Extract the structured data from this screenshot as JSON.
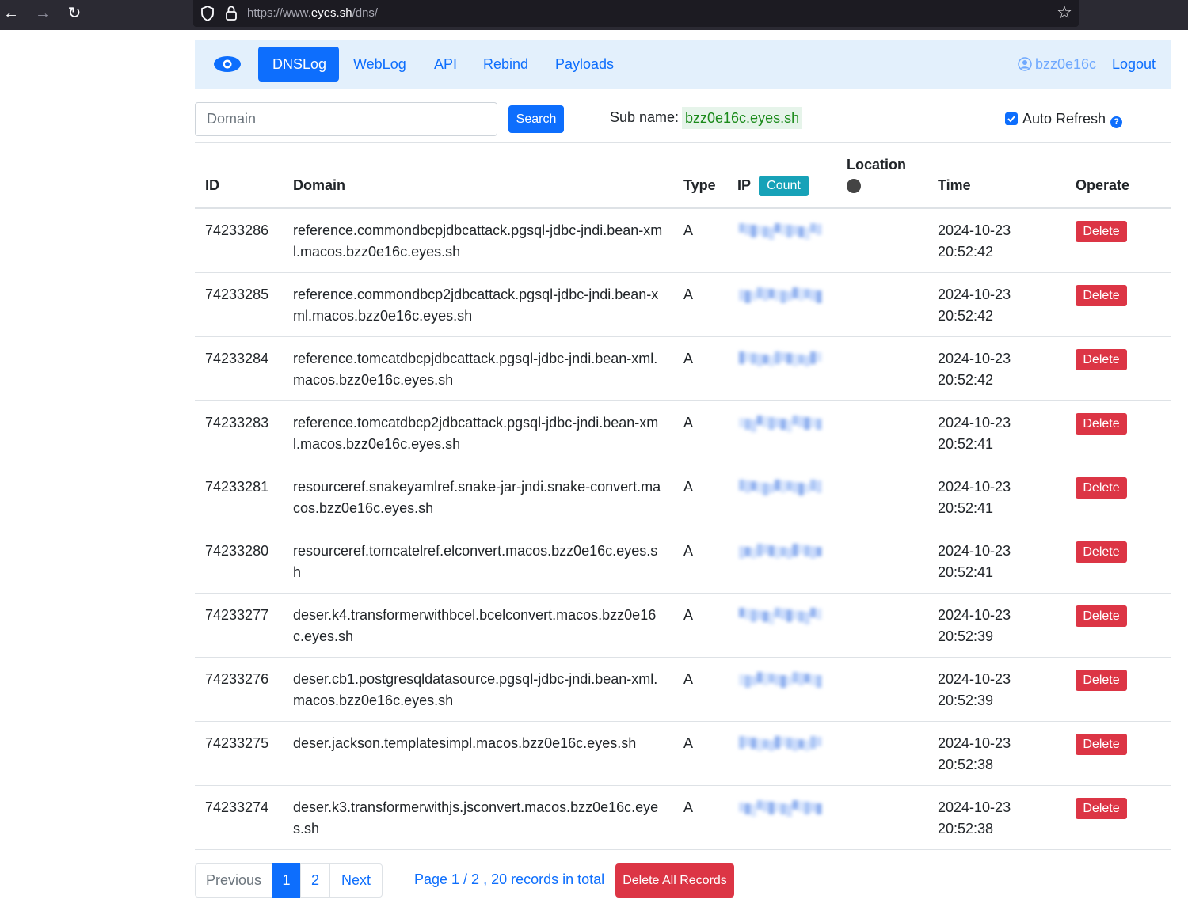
{
  "browser": {
    "url_prefix": "https://www.",
    "url_host": "eyes.sh",
    "url_path": "/dns/"
  },
  "navbar": {
    "items": [
      "DNSLog",
      "WebLog",
      "API",
      "Rebind",
      "Payloads"
    ],
    "active": "DNSLog",
    "username": "bzz0e16c",
    "logout_label": "Logout"
  },
  "search": {
    "placeholder": "Domain",
    "button_label": "Search",
    "subname_label": "Sub name:",
    "subname_value": "bzz0e16c.eyes.sh",
    "auto_refresh_label": "Auto Refresh",
    "auto_refresh_checked": true
  },
  "table": {
    "headers": {
      "id": "ID",
      "domain": "Domain",
      "type": "Type",
      "ip": "IP",
      "count": "Count",
      "location": "Location",
      "time": "Time",
      "operate": "Operate"
    },
    "delete_label": "Delete",
    "rows": [
      {
        "id": "74233286",
        "domain": "reference.commondbcpjdbcattack.pgsql-jdbc-jndi.bean-xml.macos.bzz0e16c.eyes.sh",
        "type": "A",
        "time": "2024-10-23 20:52:42"
      },
      {
        "id": "74233285",
        "domain": "reference.commondbcp2jdbcattack.pgsql-jdbc-jndi.bean-xml.macos.bzz0e16c.eyes.sh",
        "type": "A",
        "time": "2024-10-23 20:52:42"
      },
      {
        "id": "74233284",
        "domain": "reference.tomcatdbcpjdbcattack.pgsql-jdbc-jndi.bean-xml.macos.bzz0e16c.eyes.sh",
        "type": "A",
        "time": "2024-10-23 20:52:42"
      },
      {
        "id": "74233283",
        "domain": "reference.tomcatdbcp2jdbcattack.pgsql-jdbc-jndi.bean-xml.macos.bzz0e16c.eyes.sh",
        "type": "A",
        "time": "2024-10-23 20:52:41"
      },
      {
        "id": "74233281",
        "domain": "resourceref.snakeyamlref.snake-jar-jndi.snake-convert.macos.bzz0e16c.eyes.sh",
        "type": "A",
        "time": "2024-10-23 20:52:41"
      },
      {
        "id": "74233280",
        "domain": "resourceref.tomcatelref.elconvert.macos.bzz0e16c.eyes.sh",
        "type": "A",
        "time": "2024-10-23 20:52:41"
      },
      {
        "id": "74233277",
        "domain": "deser.k4.transformerwithbcel.bcelconvert.macos.bzz0e16c.eyes.sh",
        "type": "A",
        "time": "2024-10-23 20:52:39"
      },
      {
        "id": "74233276",
        "domain": "deser.cb1.postgresqldatasource.pgsql-jdbc-jndi.bean-xml.macos.bzz0e16c.eyes.sh",
        "type": "A",
        "time": "2024-10-23 20:52:39"
      },
      {
        "id": "74233275",
        "domain": "deser.jackson.templatesimpl.macos.bzz0e16c.eyes.sh",
        "type": "A",
        "time": "2024-10-23 20:52:38"
      },
      {
        "id": "74233274",
        "domain": "deser.k3.transformerwithjs.jsconvert.macos.bzz0e16c.eyes.sh",
        "type": "A",
        "time": "2024-10-23 20:52:38"
      }
    ]
  },
  "pagination": {
    "previous_label": "Previous",
    "pages": [
      "1",
      "2"
    ],
    "current": "1",
    "next_label": "Next",
    "info": "Page 1 / 2 , 20 records in total",
    "delete_all_label": "Delete All Records"
  },
  "colors": {
    "primary": "#0d6efd",
    "danger": "#dc3545",
    "info": "#17a2b8",
    "navbar_bg": "#e3f0fc",
    "subname_text": "#1a8a1a"
  },
  "icons": [
    "back-arrow-icon",
    "forward-arrow-icon",
    "reload-icon",
    "shield-icon",
    "lock-icon",
    "star-icon",
    "eye-logo-icon",
    "user-circle-icon",
    "question-icon",
    "checkbox-checked-icon"
  ]
}
